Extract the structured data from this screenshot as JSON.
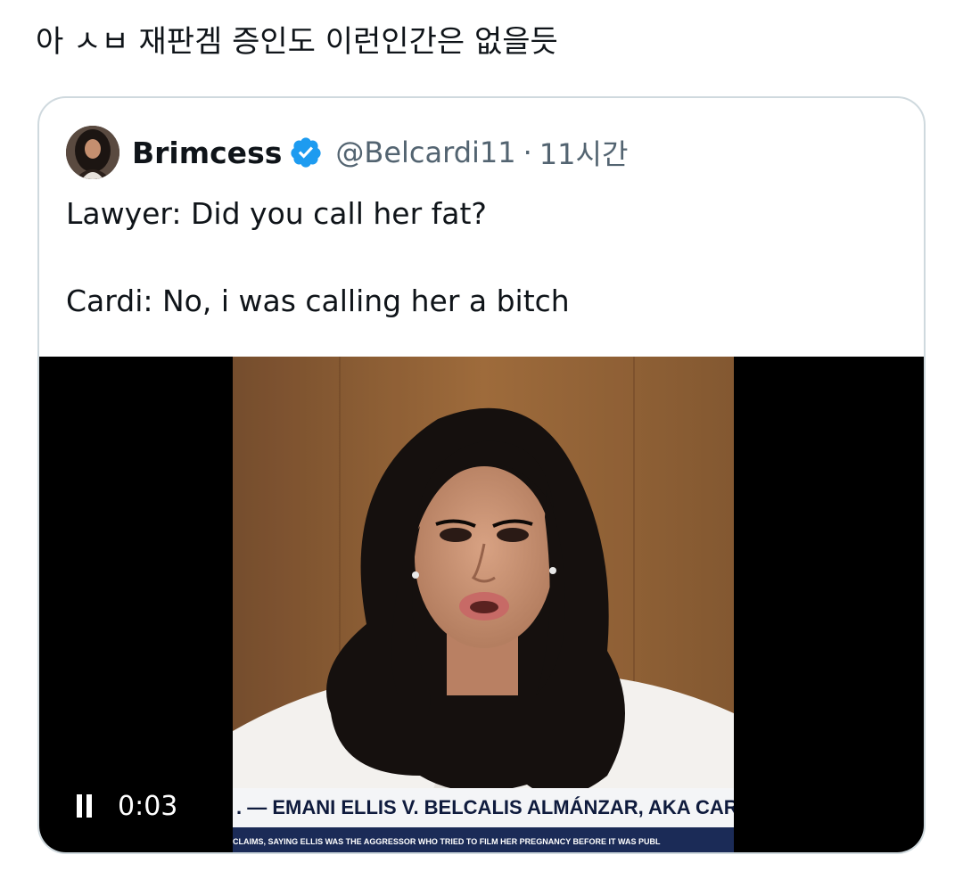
{
  "post": {
    "text": "아 ㅅㅂ 재판겜 증인도 이런인간은 없을듯"
  },
  "quoted_tweet": {
    "display_name": "Brimcess",
    "handle": "@Belcardi11",
    "separator": "·",
    "time": "11시간",
    "verified_icon": "verified-badge-icon",
    "body_lines": [
      "Lawyer: Did you call her fat?",
      "Cardi: No, i was calling her a bitch"
    ]
  },
  "video": {
    "elapsed": "0:03",
    "state_icon": "pause-icon",
    "chyron_headline": ". — EMANI ELLIS V. BELCALIS ALMÁNZAR, AKA CARDI",
    "chyron_ticker": "CLAIMS, SAYING ELLIS WAS THE AGGRESSOR WHO TRIED TO FILM HER PREGNANCY BEFORE IT WAS PUBL"
  },
  "colors": {
    "text_primary": "#0f1419",
    "text_secondary": "#536471",
    "verified_blue": "#1d9bf0",
    "card_border": "#cfd9de",
    "chyron_navy": "#1b2b57"
  }
}
